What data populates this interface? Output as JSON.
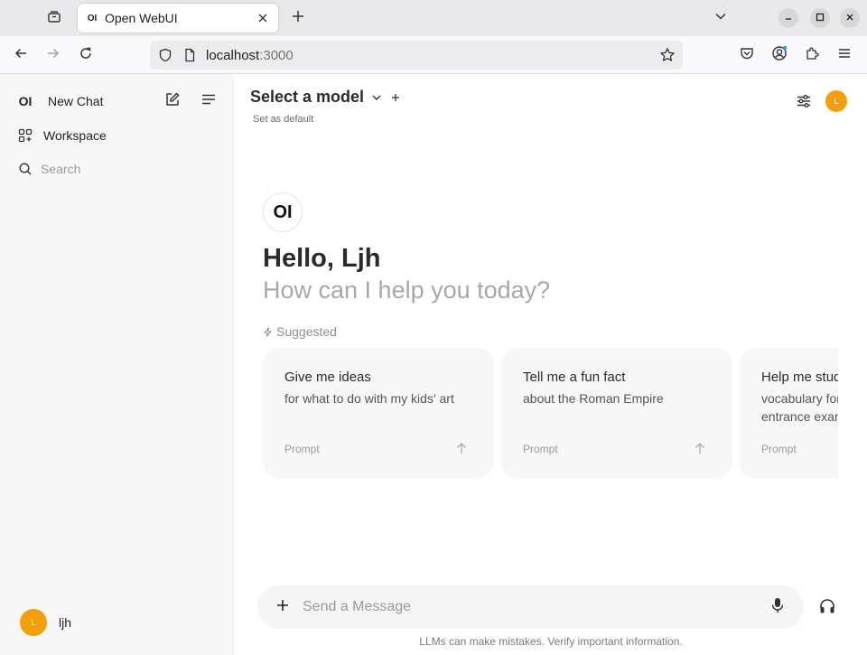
{
  "browser": {
    "tab": {
      "favicon_text": "OI",
      "title": "Open WebUI"
    },
    "url": {
      "host": "localhost",
      "port": ":3000"
    },
    "icons": [
      "tab-list-icon",
      "close-icon",
      "plus-icon",
      "chevron-down-icon",
      "minimize-icon",
      "maximize-icon",
      "close-icon",
      "back-icon",
      "forward-icon",
      "reload-icon",
      "shield-icon",
      "page-icon",
      "star-icon",
      "pocket-icon",
      "account-icon",
      "extensions-icon",
      "menu-icon"
    ]
  },
  "sidebar": {
    "logo_text": "OI",
    "new_chat_label": "New Chat",
    "workspace_label": "Workspace",
    "search_placeholder": "Search",
    "user": {
      "avatar_initial": "L",
      "name": "ljh"
    }
  },
  "header": {
    "model_select_label": "Select a model",
    "set_default_label": "Set as default",
    "avatar_initial": "L"
  },
  "hero": {
    "logo_text": "OI",
    "greeting": "Hello, Ljh",
    "subtitle": "How can I help you today?",
    "suggested_label": "Suggested"
  },
  "suggestions": [
    {
      "title": "Give me ideas",
      "subtitle": "for what to do with my kids' art",
      "prompt_label": "Prompt"
    },
    {
      "title": "Tell me a fun fact",
      "subtitle": "about the Roman Empire",
      "prompt_label": "Prompt"
    },
    {
      "title": "Help me study",
      "subtitle": "vocabulary for a college entrance exam",
      "prompt_label": "Prompt"
    }
  ],
  "input": {
    "placeholder": "Send a Message",
    "disclaimer": "LLMs can make mistakes. Verify important information."
  },
  "colors": {
    "accent_avatar": "#f59e0b",
    "sidebar_bg": "#f7f7f7",
    "card_bg": "#f7f7f7"
  }
}
